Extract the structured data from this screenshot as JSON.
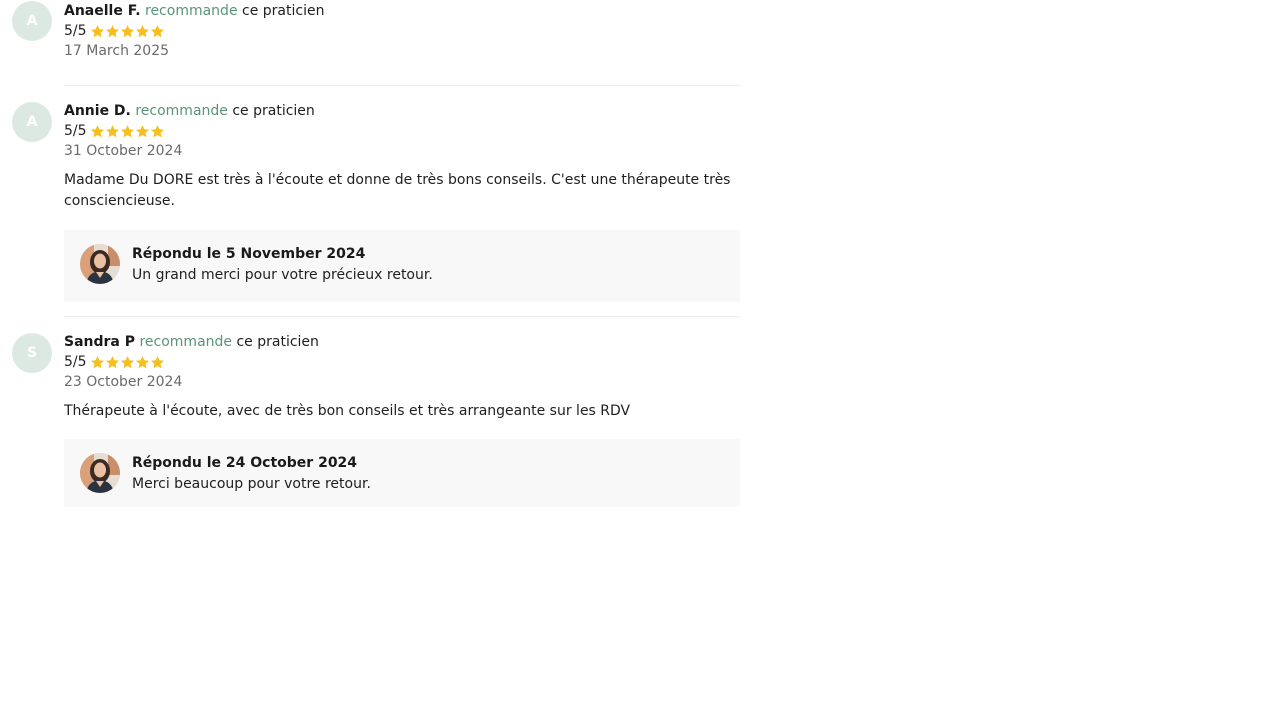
{
  "reviews": [
    {
      "initial": "A",
      "author": "Anaelle F.",
      "recommend": "recommande",
      "suffix": "ce praticien",
      "rating": "5/5",
      "stars": 5,
      "date": "17 March 2025"
    },
    {
      "initial": "A",
      "author": "Annie D.",
      "recommend": "recommande",
      "suffix": "ce praticien",
      "rating": "5/5",
      "stars": 5,
      "date": "31 October 2024",
      "comment": "Madame Du DORE est très à l'écoute et donne de très bons conseils. C'est une thérapeute très consciencieuse.",
      "reply": {
        "title": "Répondu le 5 November 2024",
        "message": "Un grand merci pour votre précieux retour."
      }
    },
    {
      "initial": "S",
      "author": "Sandra P",
      "recommend": "recommande",
      "suffix": "ce praticien",
      "rating": "5/5",
      "stars": 5,
      "date": "23 October 2024",
      "comment": "Thérapeute à l'écoute, avec de très bon conseils et très arrangeante sur les RDV",
      "reply": {
        "title": "Répondu le 24 October 2024",
        "message": "Merci beaucoup pour votre retour."
      }
    }
  ],
  "icons": {
    "star": "star-icon",
    "practitioner": "practitioner-avatar"
  },
  "colors": {
    "accent": "#5a9478",
    "star": "#f4bf1f",
    "avatar_bg": "#dce9e3",
    "reply_bg": "#f8f8f8"
  }
}
